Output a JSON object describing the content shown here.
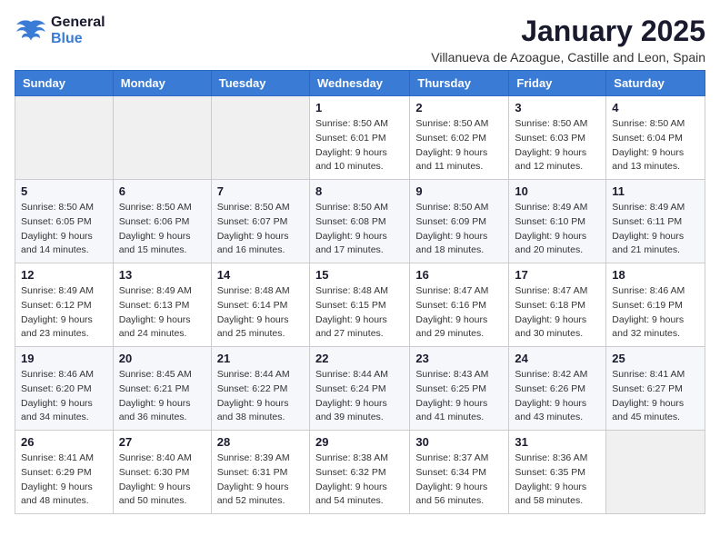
{
  "header": {
    "logo": {
      "line1": "General",
      "line2": "Blue"
    },
    "title": "January 2025",
    "location": "Villanueva de Azoague, Castille and Leon, Spain"
  },
  "days_of_week": [
    "Sunday",
    "Monday",
    "Tuesday",
    "Wednesday",
    "Thursday",
    "Friday",
    "Saturday"
  ],
  "weeks": [
    [
      {
        "day": "",
        "info": ""
      },
      {
        "day": "",
        "info": ""
      },
      {
        "day": "",
        "info": ""
      },
      {
        "day": "1",
        "info": "Sunrise: 8:50 AM\nSunset: 6:01 PM\nDaylight: 9 hours\nand 10 minutes."
      },
      {
        "day": "2",
        "info": "Sunrise: 8:50 AM\nSunset: 6:02 PM\nDaylight: 9 hours\nand 11 minutes."
      },
      {
        "day": "3",
        "info": "Sunrise: 8:50 AM\nSunset: 6:03 PM\nDaylight: 9 hours\nand 12 minutes."
      },
      {
        "day": "4",
        "info": "Sunrise: 8:50 AM\nSunset: 6:04 PM\nDaylight: 9 hours\nand 13 minutes."
      }
    ],
    [
      {
        "day": "5",
        "info": "Sunrise: 8:50 AM\nSunset: 6:05 PM\nDaylight: 9 hours\nand 14 minutes."
      },
      {
        "day": "6",
        "info": "Sunrise: 8:50 AM\nSunset: 6:06 PM\nDaylight: 9 hours\nand 15 minutes."
      },
      {
        "day": "7",
        "info": "Sunrise: 8:50 AM\nSunset: 6:07 PM\nDaylight: 9 hours\nand 16 minutes."
      },
      {
        "day": "8",
        "info": "Sunrise: 8:50 AM\nSunset: 6:08 PM\nDaylight: 9 hours\nand 17 minutes."
      },
      {
        "day": "9",
        "info": "Sunrise: 8:50 AM\nSunset: 6:09 PM\nDaylight: 9 hours\nand 18 minutes."
      },
      {
        "day": "10",
        "info": "Sunrise: 8:49 AM\nSunset: 6:10 PM\nDaylight: 9 hours\nand 20 minutes."
      },
      {
        "day": "11",
        "info": "Sunrise: 8:49 AM\nSunset: 6:11 PM\nDaylight: 9 hours\nand 21 minutes."
      }
    ],
    [
      {
        "day": "12",
        "info": "Sunrise: 8:49 AM\nSunset: 6:12 PM\nDaylight: 9 hours\nand 23 minutes."
      },
      {
        "day": "13",
        "info": "Sunrise: 8:49 AM\nSunset: 6:13 PM\nDaylight: 9 hours\nand 24 minutes."
      },
      {
        "day": "14",
        "info": "Sunrise: 8:48 AM\nSunset: 6:14 PM\nDaylight: 9 hours\nand 25 minutes."
      },
      {
        "day": "15",
        "info": "Sunrise: 8:48 AM\nSunset: 6:15 PM\nDaylight: 9 hours\nand 27 minutes."
      },
      {
        "day": "16",
        "info": "Sunrise: 8:47 AM\nSunset: 6:16 PM\nDaylight: 9 hours\nand 29 minutes."
      },
      {
        "day": "17",
        "info": "Sunrise: 8:47 AM\nSunset: 6:18 PM\nDaylight: 9 hours\nand 30 minutes."
      },
      {
        "day": "18",
        "info": "Sunrise: 8:46 AM\nSunset: 6:19 PM\nDaylight: 9 hours\nand 32 minutes."
      }
    ],
    [
      {
        "day": "19",
        "info": "Sunrise: 8:46 AM\nSunset: 6:20 PM\nDaylight: 9 hours\nand 34 minutes."
      },
      {
        "day": "20",
        "info": "Sunrise: 8:45 AM\nSunset: 6:21 PM\nDaylight: 9 hours\nand 36 minutes."
      },
      {
        "day": "21",
        "info": "Sunrise: 8:44 AM\nSunset: 6:22 PM\nDaylight: 9 hours\nand 38 minutes."
      },
      {
        "day": "22",
        "info": "Sunrise: 8:44 AM\nSunset: 6:24 PM\nDaylight: 9 hours\nand 39 minutes."
      },
      {
        "day": "23",
        "info": "Sunrise: 8:43 AM\nSunset: 6:25 PM\nDaylight: 9 hours\nand 41 minutes."
      },
      {
        "day": "24",
        "info": "Sunrise: 8:42 AM\nSunset: 6:26 PM\nDaylight: 9 hours\nand 43 minutes."
      },
      {
        "day": "25",
        "info": "Sunrise: 8:41 AM\nSunset: 6:27 PM\nDaylight: 9 hours\nand 45 minutes."
      }
    ],
    [
      {
        "day": "26",
        "info": "Sunrise: 8:41 AM\nSunset: 6:29 PM\nDaylight: 9 hours\nand 48 minutes."
      },
      {
        "day": "27",
        "info": "Sunrise: 8:40 AM\nSunset: 6:30 PM\nDaylight: 9 hours\nand 50 minutes."
      },
      {
        "day": "28",
        "info": "Sunrise: 8:39 AM\nSunset: 6:31 PM\nDaylight: 9 hours\nand 52 minutes."
      },
      {
        "day": "29",
        "info": "Sunrise: 8:38 AM\nSunset: 6:32 PM\nDaylight: 9 hours\nand 54 minutes."
      },
      {
        "day": "30",
        "info": "Sunrise: 8:37 AM\nSunset: 6:34 PM\nDaylight: 9 hours\nand 56 minutes."
      },
      {
        "day": "31",
        "info": "Sunrise: 8:36 AM\nSunset: 6:35 PM\nDaylight: 9 hours\nand 58 minutes."
      },
      {
        "day": "",
        "info": ""
      }
    ]
  ]
}
